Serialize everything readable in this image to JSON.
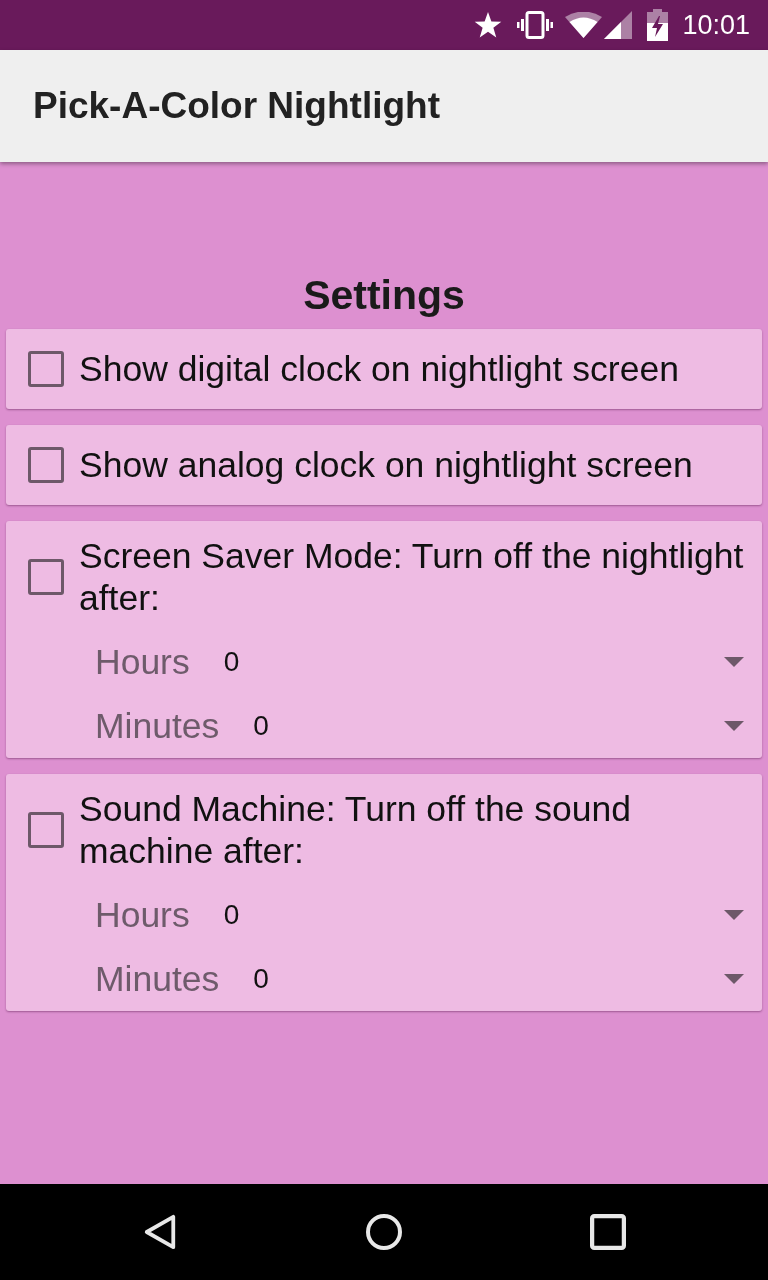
{
  "status_bar": {
    "time": "10:01"
  },
  "app_bar": {
    "title": "Pick-A-Color Nightlight"
  },
  "heading": "Settings",
  "settings": [
    {
      "kind": "checkbox",
      "label": "Show digital clock on nightlight screen",
      "checked": false
    },
    {
      "kind": "checkbox",
      "label": "Show analog clock on nightlight screen",
      "checked": false
    },
    {
      "kind": "timer",
      "label": "Screen Saver Mode: Turn off the nightlight after:",
      "checked": false,
      "fields": [
        {
          "label": "Hours",
          "value": "0"
        },
        {
          "label": "Minutes",
          "value": "0"
        }
      ]
    },
    {
      "kind": "timer",
      "label": "Sound Machine: Turn off the sound machine after:",
      "checked": false,
      "fields": [
        {
          "label": "Hours",
          "value": "0"
        },
        {
          "label": "Minutes",
          "value": "0"
        }
      ]
    }
  ]
}
